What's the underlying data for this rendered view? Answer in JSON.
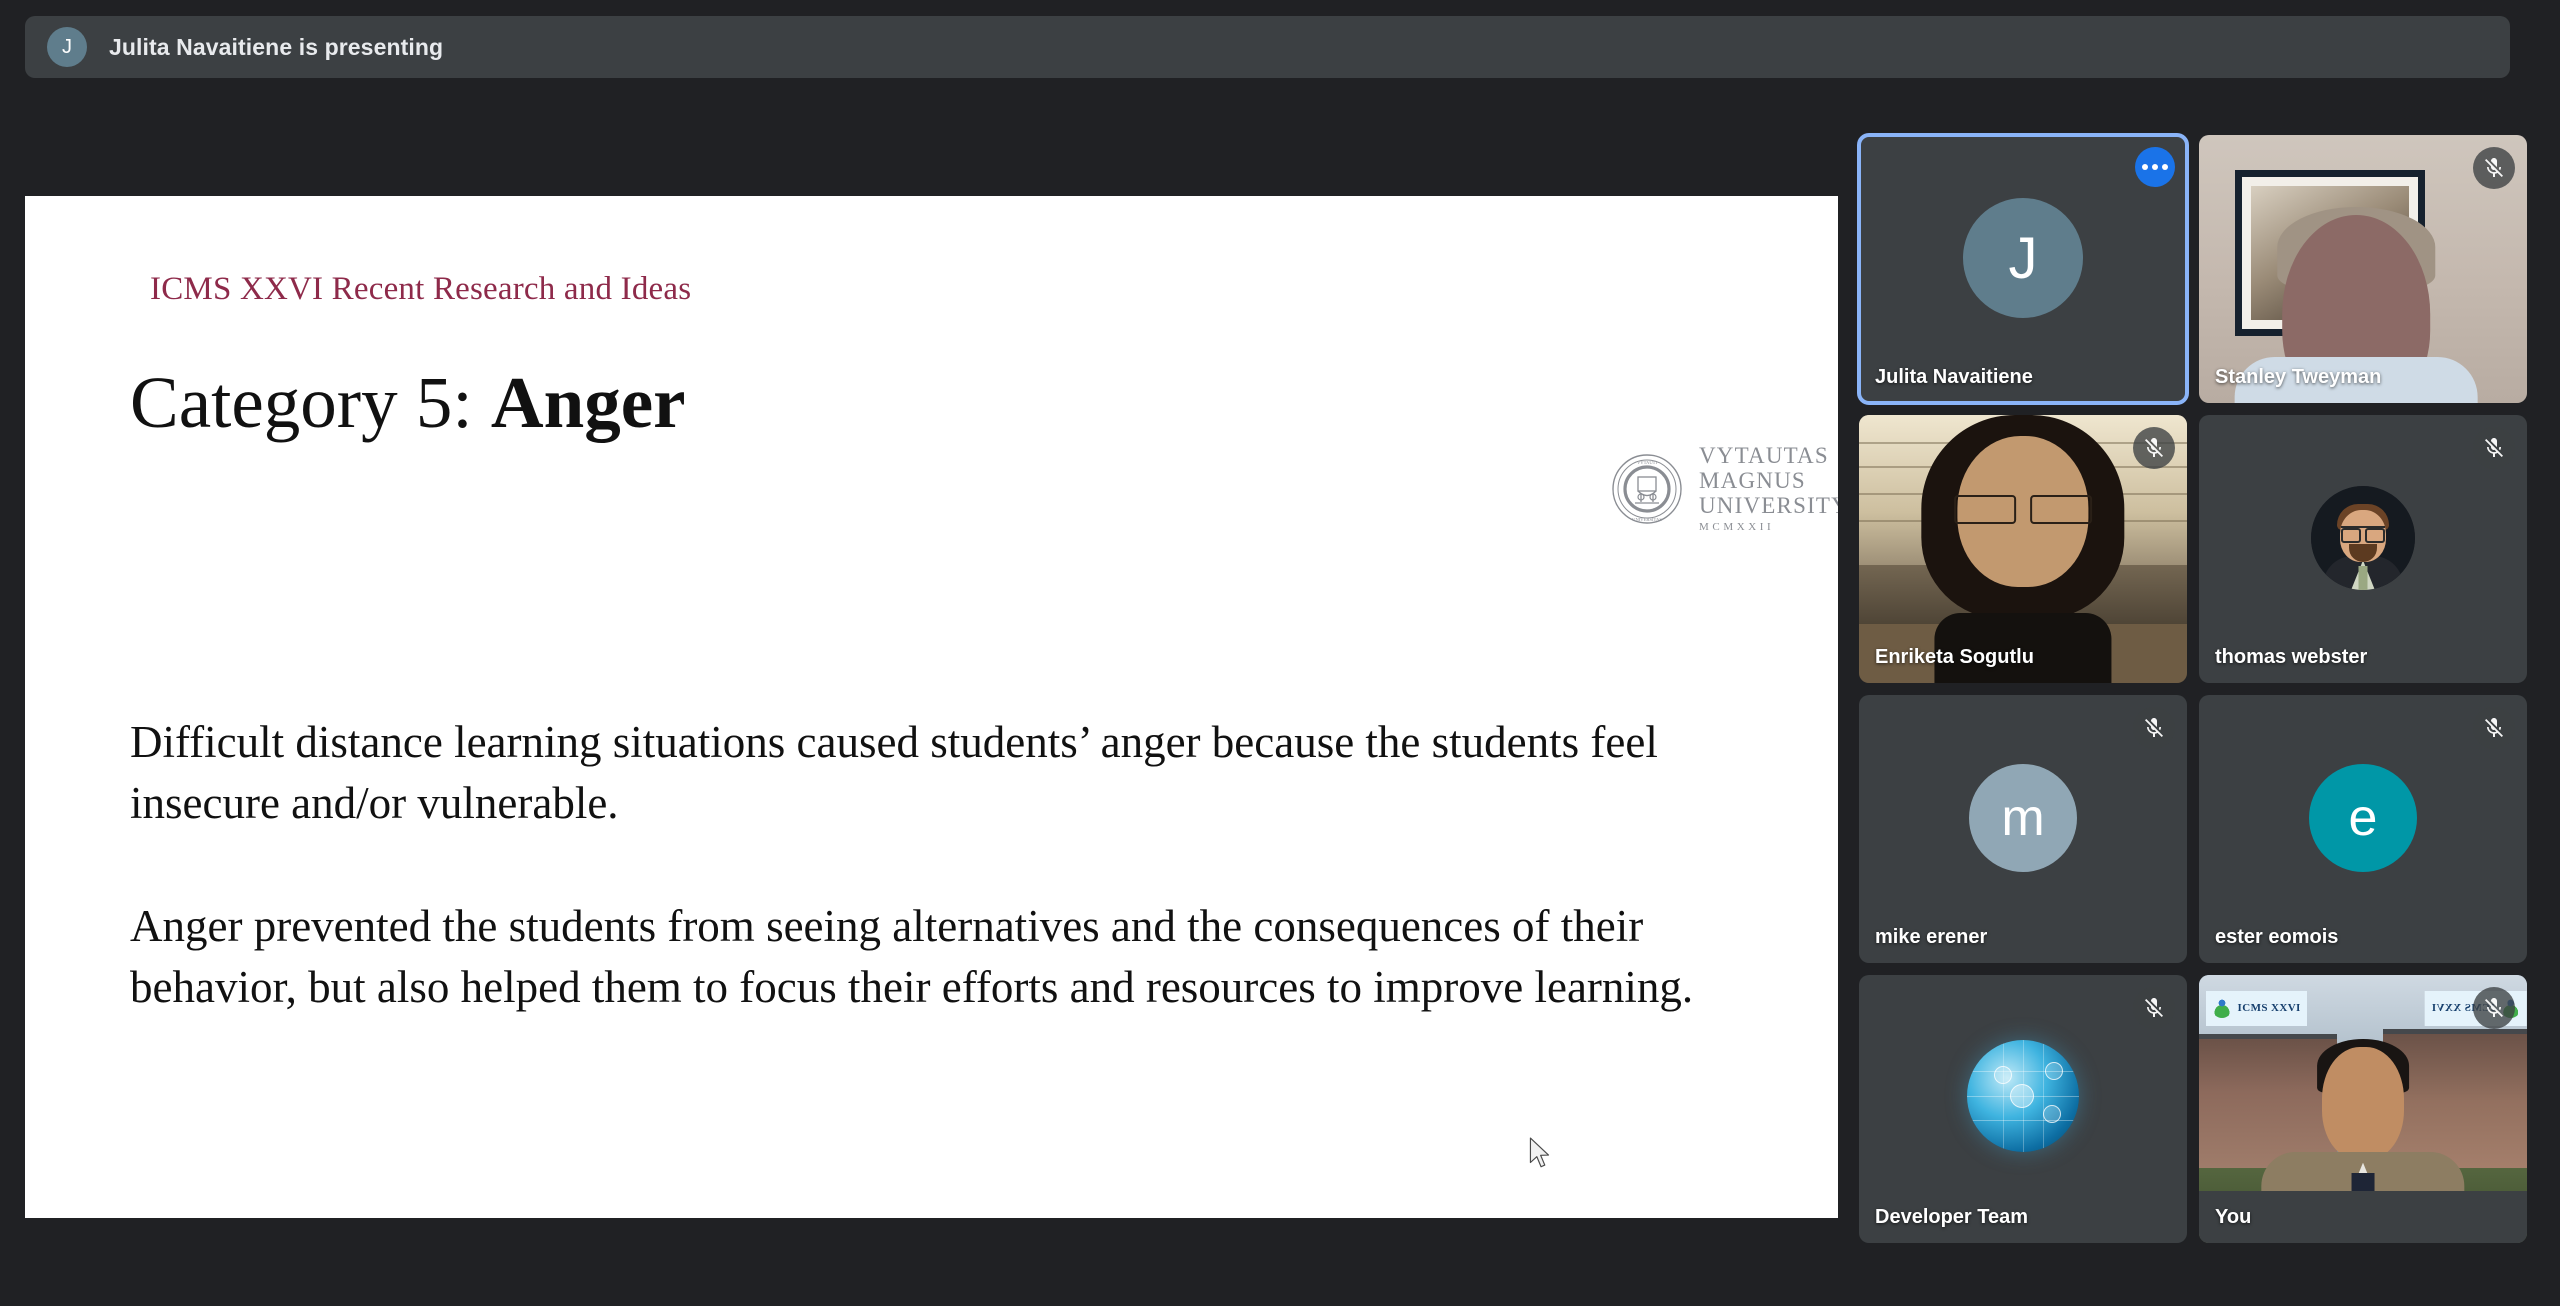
{
  "app": {
    "name": "video-conference",
    "background_color": "#202124",
    "accent_color": "#8ab4f8",
    "tile_color": "#3c4043"
  },
  "banner": {
    "avatar_initial": "J",
    "text": "Julita Navaitiene is presenting"
  },
  "slide": {
    "eyebrow": "ICMS XXVI Recent Research and Ideas",
    "title_regular": "Category 5: ",
    "title_bold": "Anger",
    "paragraph_1": "Difficult distance learning situations caused students’ anger because the students feel insecure and/or vulnerable.",
    "paragraph_2": "Anger prevented the students from seeing alternatives and the consequences of their behavior, but also helped them to focus their efforts and resources to improve learning.",
    "logo": {
      "line1": "VYTAUTAS",
      "line2": "MAGNUS",
      "line3": "UNIVERSITY",
      "year": "MCMXXII",
      "seal_alt": "university-seal"
    }
  },
  "participants": [
    {
      "name": "Julita Navaitiene",
      "kind": "letter-avatar",
      "initial": "J",
      "avatar_color": "#5f7d8c",
      "active_speaker": true,
      "muted": false,
      "has_more_button": true,
      "more_button_label": "More options"
    },
    {
      "name": "Stanley Tweyman",
      "kind": "video",
      "active_speaker": false,
      "muted": true
    },
    {
      "name": "Enriketa Sogutlu",
      "kind": "video",
      "active_speaker": false,
      "muted": true
    },
    {
      "name": "thomas webster",
      "kind": "photo-avatar",
      "active_speaker": false,
      "muted": true
    },
    {
      "name": "mike erener",
      "kind": "letter-avatar",
      "initial": "m",
      "avatar_color": "#90a7b5",
      "active_speaker": false,
      "muted": true
    },
    {
      "name": "ester eomois",
      "kind": "letter-avatar",
      "initial": "e",
      "avatar_color": "#0097a7",
      "active_speaker": false,
      "muted": true
    },
    {
      "name": "Developer Team",
      "kind": "globe-avatar",
      "active_speaker": false,
      "muted": true
    },
    {
      "name": "You",
      "kind": "video",
      "active_speaker": false,
      "muted": true,
      "background_banner_text": "ICMS XXVI"
    }
  ],
  "icons": {
    "mic_off": "mic-off-icon",
    "more": "more-options-icon",
    "cursor": "mouse-pointer"
  }
}
